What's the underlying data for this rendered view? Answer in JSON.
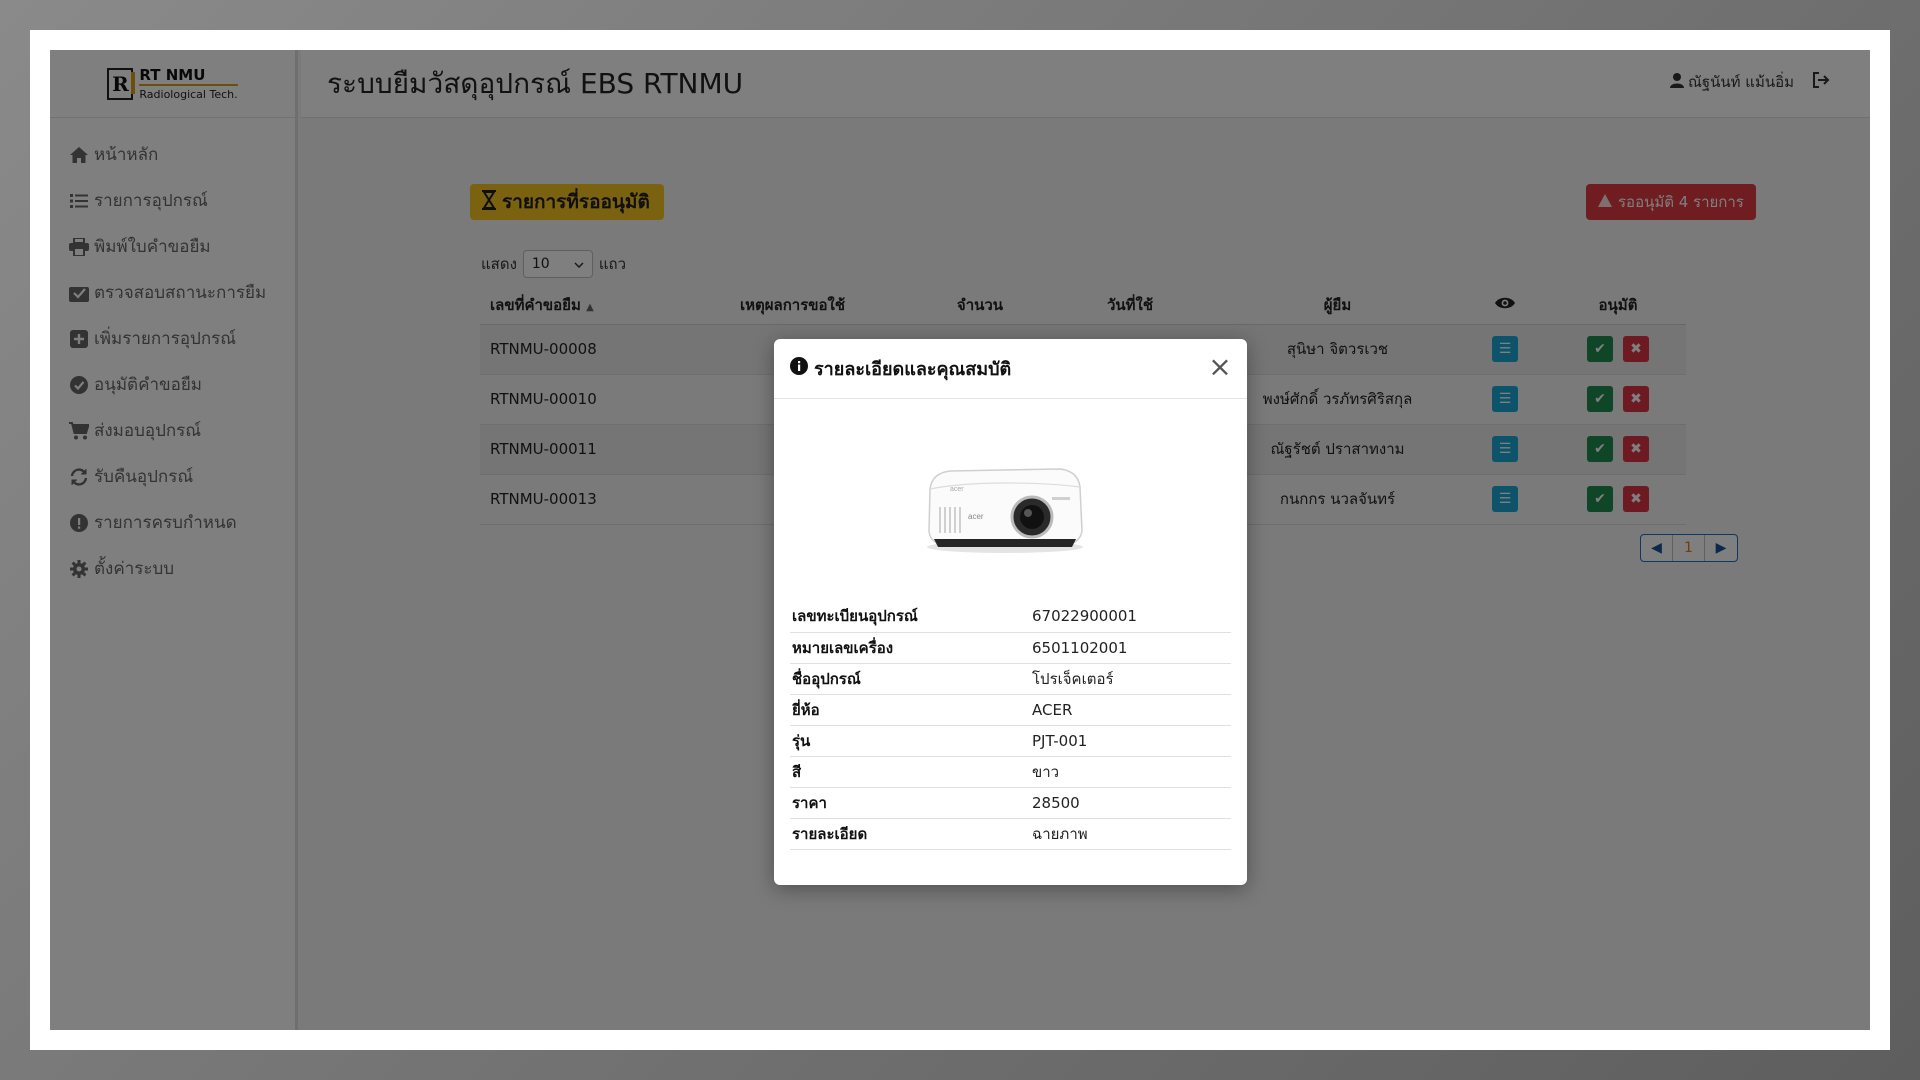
{
  "brand": {
    "logo_letter": "R",
    "title": "RT NMU",
    "subtitle": "Radiological Tech."
  },
  "header": {
    "title": "ระบบยืมวัสดุอุปกรณ์ EBS RTNMU",
    "user_name": "ณัฐนันท์ แม้นอิ่ม"
  },
  "sidebar": {
    "items": [
      {
        "label": "หน้าหลัก",
        "icon": "home-icon"
      },
      {
        "label": "รายการอุปกรณ์",
        "icon": "list-icon"
      },
      {
        "label": "พิมพ์ใบคำขอยืม",
        "icon": "printer-icon"
      },
      {
        "label": "ตรวจสอบสถานะการยืม",
        "icon": "inbox-check-icon"
      },
      {
        "label": "เพิ่มรายการอุปกรณ์",
        "icon": "plus-square-icon"
      },
      {
        "label": "อนุมัติคำขอยืม",
        "icon": "check-circle-icon"
      },
      {
        "label": "ส่งมอบอุปกรณ์",
        "icon": "cart-icon"
      },
      {
        "label": "รับคืนอุปกรณ์",
        "icon": "return-icon"
      },
      {
        "label": "รายการครบกำหนด",
        "icon": "alert-circle-icon"
      },
      {
        "label": "ตั้งค่าระบบ",
        "icon": "gear-icon"
      }
    ]
  },
  "main": {
    "section_title": "รายการที่รออนุมัติ",
    "pending_badge": "รออนุมัติ 4 รายการ",
    "length_label_before": "แสดง",
    "length_value": "10",
    "length_label_after": "แถว",
    "table": {
      "columns": [
        "เลขที่คำขอยืม",
        "เหตุผลการขอใช้",
        "จำนวน",
        "วันที่ใช้",
        "ผู้ยืม",
        "",
        "อนุมัติ"
      ],
      "rows": [
        {
          "id": "RTNMU-00008",
          "borrower": "สุนิษา จิตวรเวช"
        },
        {
          "id": "RTNMU-00010",
          "borrower": "พงษ์ศักดิ์ วรภัทรศิริสกุล"
        },
        {
          "id": "RTNMU-00011",
          "borrower": "ณัฐรัชต์ ปราสาทงาม"
        },
        {
          "id": "RTNMU-00013",
          "borrower": "กนกกร นวลจันทร์"
        }
      ]
    },
    "pagination": {
      "current": "1"
    }
  },
  "modal": {
    "title": "รายละเอียดและคุณสมบัติ",
    "rows": [
      {
        "label": "เลขทะเบียนอุปกรณ์",
        "value": "67022900001"
      },
      {
        "label": "หมายเลขเครื่อง",
        "value": "6501102001"
      },
      {
        "label": "ชื่ออุปกรณ์",
        "value": "โปรเจ็คเตอร์"
      },
      {
        "label": "ยี่ห้อ",
        "value": "ACER"
      },
      {
        "label": "รุ่น",
        "value": "PJT-001"
      },
      {
        "label": "สี",
        "value": "ขาว"
      },
      {
        "label": "ราคา",
        "value": "28500"
      },
      {
        "label": "รายละเอียด",
        "value": "ฉายภาพ"
      }
    ]
  },
  "colors": {
    "section_title_bg": "#f6c520",
    "badge_bg": "#e03a44",
    "info_button": "#1ba8d6",
    "approve_button": "#1e8c4e",
    "reject_button": "#dc3545"
  }
}
